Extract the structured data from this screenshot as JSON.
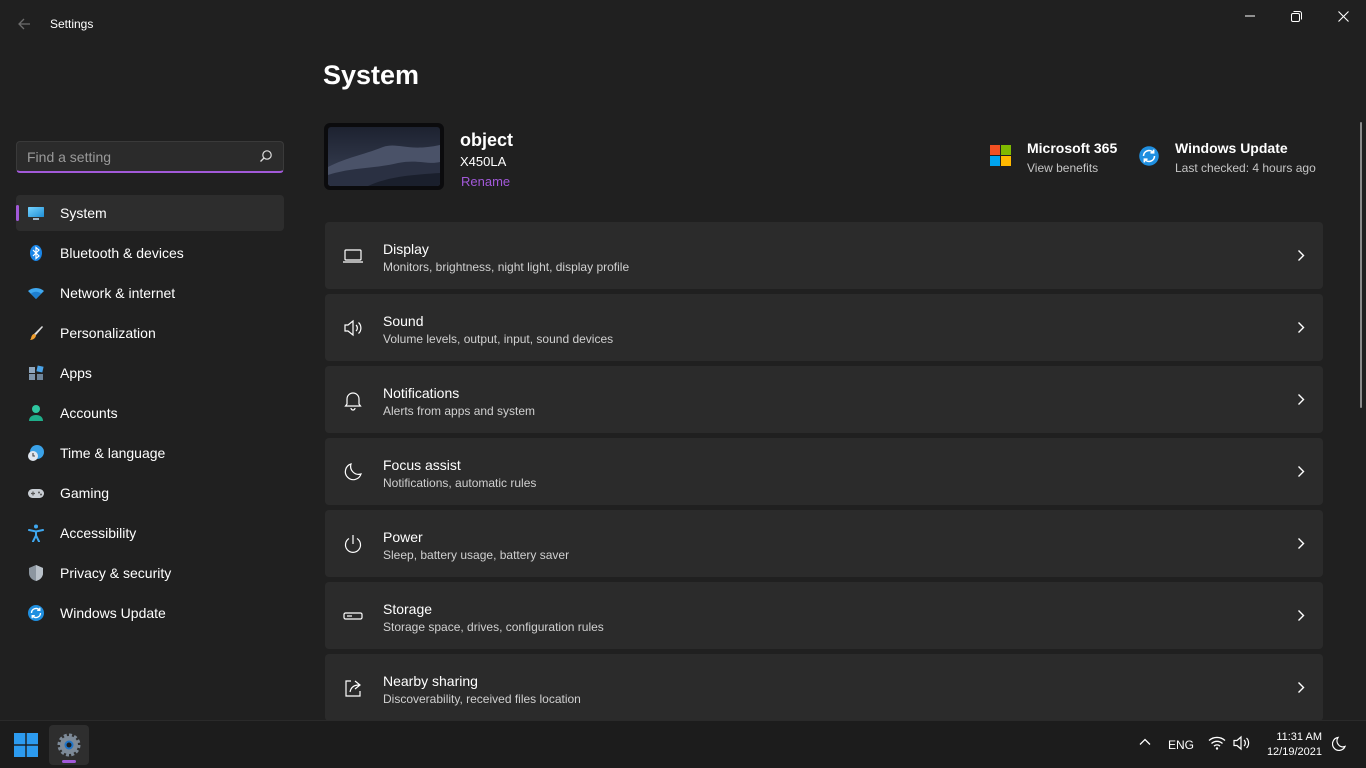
{
  "window": {
    "title": "Settings"
  },
  "sidebar": {
    "search_placeholder": "Find a setting",
    "items": [
      {
        "label": "System",
        "icon": "monitor-icon",
        "active": true
      },
      {
        "label": "Bluetooth & devices",
        "icon": "bluetooth-icon"
      },
      {
        "label": "Network & internet",
        "icon": "wifi-icon"
      },
      {
        "label": "Personalization",
        "icon": "brush-icon"
      },
      {
        "label": "Apps",
        "icon": "apps-icon"
      },
      {
        "label": "Accounts",
        "icon": "person-icon"
      },
      {
        "label": "Time & language",
        "icon": "globe-clock-icon"
      },
      {
        "label": "Gaming",
        "icon": "gamepad-icon"
      },
      {
        "label": "Accessibility",
        "icon": "accessibility-icon"
      },
      {
        "label": "Privacy & security",
        "icon": "shield-icon"
      },
      {
        "label": "Windows Update",
        "icon": "update-icon"
      }
    ]
  },
  "main": {
    "title": "System",
    "device": {
      "name": "object",
      "model": "X450LA",
      "rename": "Rename"
    },
    "quick_links": [
      {
        "title": "Microsoft 365",
        "subtitle": "View benefits",
        "icon": "microsoft-logo-icon"
      },
      {
        "title": "Windows Update",
        "subtitle": "Last checked: 4 hours ago",
        "icon": "update-icon"
      }
    ],
    "cards": [
      {
        "title": "Display",
        "desc": "Monitors, brightness, night light, display profile",
        "icon": "display-icon"
      },
      {
        "title": "Sound",
        "desc": "Volume levels, output, input, sound devices",
        "icon": "speaker-icon"
      },
      {
        "title": "Notifications",
        "desc": "Alerts from apps and system",
        "icon": "bell-icon"
      },
      {
        "title": "Focus assist",
        "desc": "Notifications, automatic rules",
        "icon": "moon-icon"
      },
      {
        "title": "Power",
        "desc": "Sleep, battery usage, battery saver",
        "icon": "power-icon"
      },
      {
        "title": "Storage",
        "desc": "Storage space, drives, configuration rules",
        "icon": "storage-icon"
      },
      {
        "title": "Nearby sharing",
        "desc": "Discoverability, received files location",
        "icon": "share-icon"
      }
    ]
  },
  "taskbar": {
    "language": "ENG",
    "time": "11:31 AM",
    "date": "12/19/2021"
  },
  "colors": {
    "accent": "#a259d9",
    "background": "#202020",
    "card": "#2b2b2b"
  }
}
